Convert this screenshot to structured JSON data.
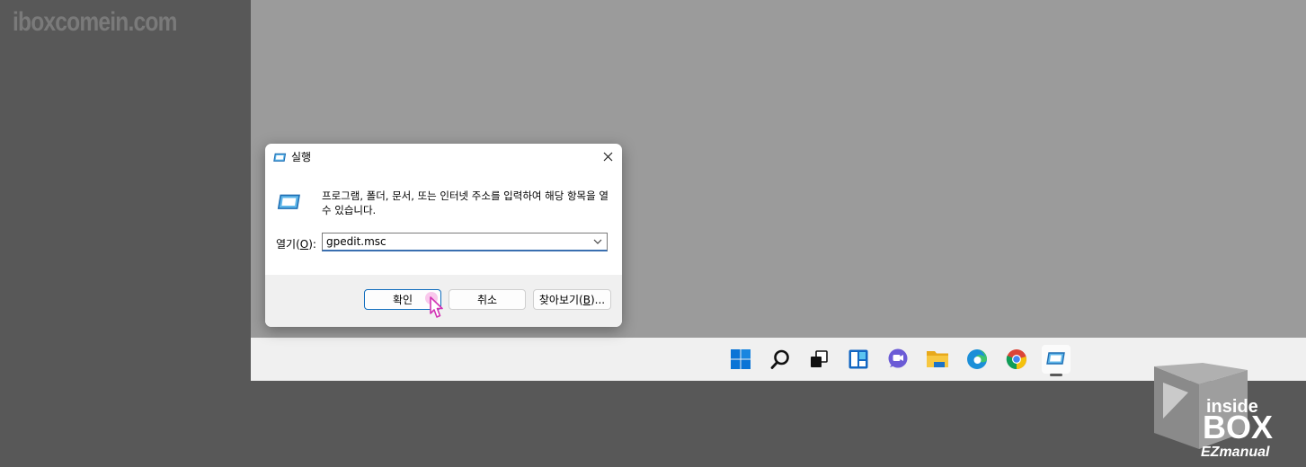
{
  "watermark": "iboxcomein.com",
  "dialog": {
    "title": "실행",
    "description": "프로그램, 폴더, 문서, 또는 인터넷 주소를 입력하여 해당 항목을 열 수 있습니다.",
    "open_label_prefix": "열기(",
    "open_label_mnemonic": "O",
    "open_label_suffix": "):",
    "input_value": "gpedit.msc",
    "ok_label": "확인",
    "cancel_label": "취소",
    "browse_prefix": "찾아보기(",
    "browse_mnemonic": "B",
    "browse_suffix": ")..."
  },
  "taskbar": {
    "icons": [
      "windows-start-icon",
      "search-icon",
      "task-view-icon",
      "widgets-icon",
      "chat-icon",
      "file-explorer-icon",
      "edge-icon",
      "chrome-icon",
      "run-app-icon"
    ],
    "active": "run-app-icon"
  },
  "logo": {
    "line1": "inside",
    "line2": "BOX",
    "line3": "EZmanual"
  },
  "colors": {
    "accent": "#0f6cbd",
    "desktop": "#9b9b9b",
    "background": "#585858",
    "taskbar": "#f0f0f0"
  }
}
